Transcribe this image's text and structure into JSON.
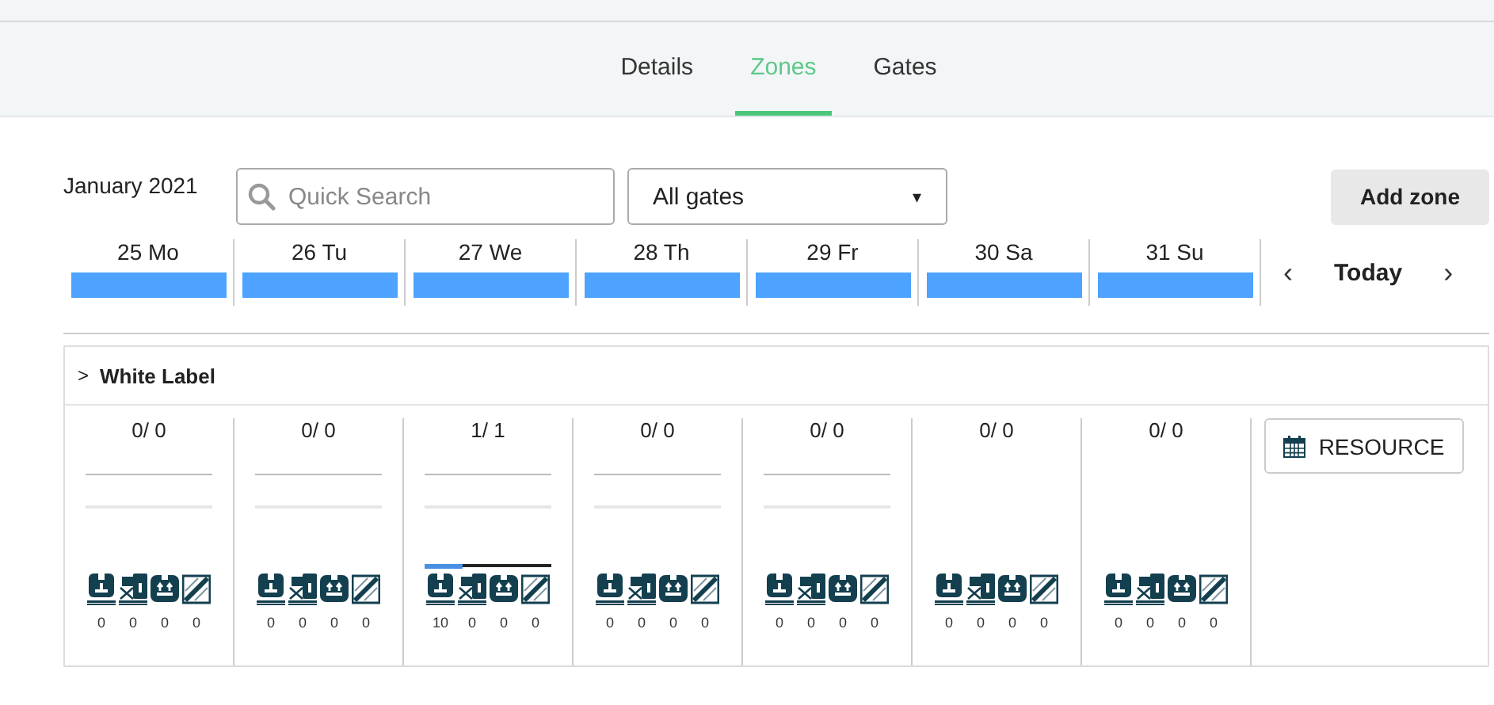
{
  "tabs": [
    {
      "label": "Details",
      "selected": false
    },
    {
      "label": "Zones",
      "selected": true
    },
    {
      "label": "Gates",
      "selected": false
    }
  ],
  "toolbar": {
    "month": "January 2021",
    "search": {
      "placeholder": "Quick Search"
    },
    "gate_select": {
      "value": "All gates",
      "caret": "▾"
    },
    "add_button": "Add zone"
  },
  "days": [
    {
      "label": "25 Mo"
    },
    {
      "label": "26 Tu"
    },
    {
      "label": "27 We"
    },
    {
      "label": "28 Th"
    },
    {
      "label": "29 Fr"
    },
    {
      "label": "30 Sa"
    },
    {
      "label": "31 Su"
    }
  ],
  "nav": {
    "prev": "‹",
    "today": "Today",
    "next": "›"
  },
  "zone": {
    "name": "White Label",
    "expanded": false,
    "toggle": ">",
    "resource_button": "RESOURCE",
    "days": [
      {
        "ratio": "0/ 0",
        "slots": true,
        "counts": [
          "0",
          "0",
          "0",
          "0"
        ]
      },
      {
        "ratio": "0/ 0",
        "slots": true,
        "counts": [
          "0",
          "0",
          "0",
          "0"
        ]
      },
      {
        "ratio": "1/ 1",
        "slots": true,
        "capacity": {
          "level": 0.3
        },
        "counts": [
          "10",
          "0",
          "0",
          "0"
        ]
      },
      {
        "ratio": "0/ 0",
        "slots": true,
        "counts": [
          "0",
          "0",
          "0",
          "0"
        ]
      },
      {
        "ratio": "0/ 0",
        "slots": true,
        "counts": [
          "0",
          "0",
          "0",
          "0"
        ]
      },
      {
        "ratio": "0/ 0",
        "slots": false,
        "counts": [
          "0",
          "0",
          "0",
          "0"
        ]
      },
      {
        "ratio": "0/ 0",
        "slots": false,
        "counts": [
          "0",
          "0",
          "0",
          "0"
        ]
      }
    ]
  }
}
